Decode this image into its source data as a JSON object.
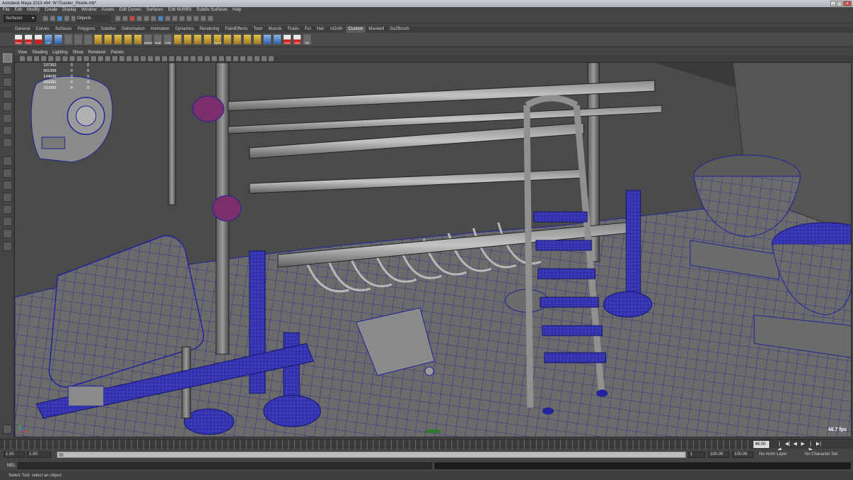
{
  "title": "Autodesk Maya 2013 x64: W:\\Toaster_INside.mb*",
  "window_buttons": {
    "minimize": "_",
    "maximize": "□",
    "close": "x"
  },
  "menus": [
    "File",
    "Edit",
    "Modify",
    "Create",
    "Display",
    "Window",
    "Assets",
    "Edit Curves",
    "Surfaces",
    "Edit NURBS",
    "Subdiv Surfaces",
    "Help"
  ],
  "status_line": {
    "mode": "Surfaces",
    "selection_mode": "Objects"
  },
  "shelf_tabs": [
    "General",
    "Curves",
    "Surfaces",
    "Polygons",
    "Subdivs",
    "Deformation",
    "Animation",
    "Dynamics",
    "Rendering",
    "PaintEffects",
    "Toon",
    "Muscle",
    "Fluids",
    "Fur",
    "Hair",
    "nCloth",
    "Custom",
    "Maxwell",
    "GoZBrush"
  ],
  "active_shelf_tab": "Custom",
  "shelf_icons": [
    {
      "label": "DSo",
      "icon": "dso-icon",
      "style": "red"
    },
    {
      "label": "Hist",
      "icon": "history-icon",
      "style": "red"
    },
    {
      "label": "",
      "icon": "ffd-icon",
      "style": "red"
    },
    {
      "label": "CP",
      "icon": "cp-icon",
      "style": "blue"
    },
    {
      "label": "",
      "icon": "spray-icon",
      "style": "blue"
    },
    {
      "label": "",
      "icon": "sphere-icon",
      "style": ""
    },
    {
      "label": "",
      "icon": "cube-icon",
      "style": ""
    },
    {
      "label": "",
      "icon": "cylinder-icon",
      "style": ""
    },
    {
      "label": "",
      "icon": "cone-icon",
      "style": "gold"
    },
    {
      "label": "",
      "icon": "plane-icon",
      "style": "gold"
    },
    {
      "label": "",
      "icon": "torus-icon",
      "style": "gold"
    },
    {
      "label": "",
      "icon": "prism-icon",
      "style": "gold"
    },
    {
      "label": "",
      "icon": "pyramid-icon",
      "style": "gold"
    },
    {
      "label": "Mshd",
      "icon": "mesh-display-icon",
      "style": ""
    },
    {
      "label": "Outl",
      "icon": "outliner-icon",
      "style": ""
    },
    {
      "label": "UTE",
      "icon": "uv-editor-icon",
      "style": ""
    },
    {
      "label": "",
      "icon": "extrude-icon",
      "style": "gold"
    },
    {
      "label": "",
      "icon": "bridge-icon",
      "style": "gold"
    },
    {
      "label": "",
      "icon": "append-icon",
      "style": "gold"
    },
    {
      "label": "",
      "icon": "split-icon",
      "style": "gold"
    },
    {
      "label": "SpNr",
      "icon": "soften-normals-icon",
      "style": "gold"
    },
    {
      "label": "",
      "icon": "bevel-icon",
      "style": "gold"
    },
    {
      "label": "",
      "icon": "merge-icon",
      "style": "gold"
    },
    {
      "label": "",
      "icon": "combine-icon",
      "style": "gold"
    },
    {
      "label": "",
      "icon": "separate-icon",
      "style": "gold"
    },
    {
      "label": "",
      "icon": "mirror-icon",
      "style": "blue"
    },
    {
      "label": "",
      "icon": "smooth-icon",
      "style": "blue"
    },
    {
      "label": "Hist",
      "icon": "history-icon",
      "style": "red"
    },
    {
      "label": "Hist",
      "icon": "history-icon",
      "style": "red"
    },
    {
      "label": "SS",
      "icon": "smooth-shade-icon",
      "style": ""
    }
  ],
  "panel_menu": [
    "View",
    "Shading",
    "Lighting",
    "Show",
    "Renderer",
    "Panels"
  ],
  "hud_stats": [
    {
      "label": "Verts:",
      "a": "197362",
      "b": "0",
      "c": "0"
    },
    {
      "label": "Edges:",
      "a": "391958",
      "b": "0",
      "c": "0"
    },
    {
      "label": "Faces:",
      "a": "194695",
      "b": "0",
      "c": "0"
    },
    {
      "label": "Tris:",
      "a": "389381",
      "b": "0",
      "c": "0"
    },
    {
      "label": "UVs:",
      "a": "232083",
      "b": "0",
      "c": "0"
    }
  ],
  "fps": "46.7 fps",
  "camera_label": "persp",
  "time_slider": {
    "current_frame": "48.00",
    "play_controls": [
      "|◀",
      "◀|",
      "◀",
      "▶",
      "|▶",
      "▶|"
    ]
  },
  "range_slider": {
    "start_time": "1.00",
    "playback_start": "1.00",
    "playback_end_marker": "1",
    "playback_end": "100.00",
    "end_time": "100.00",
    "anim_layer": "No Anim Layer",
    "character_set": "No Character Set"
  },
  "mel": {
    "label": "MEL"
  },
  "help_line": "Select Tool: select an object",
  "colors": {
    "wire_blue": "#1a1aa8",
    "mesh_grey": "#6d6d6d",
    "background": "#444444",
    "accent_purple": "#7a2e6a"
  }
}
